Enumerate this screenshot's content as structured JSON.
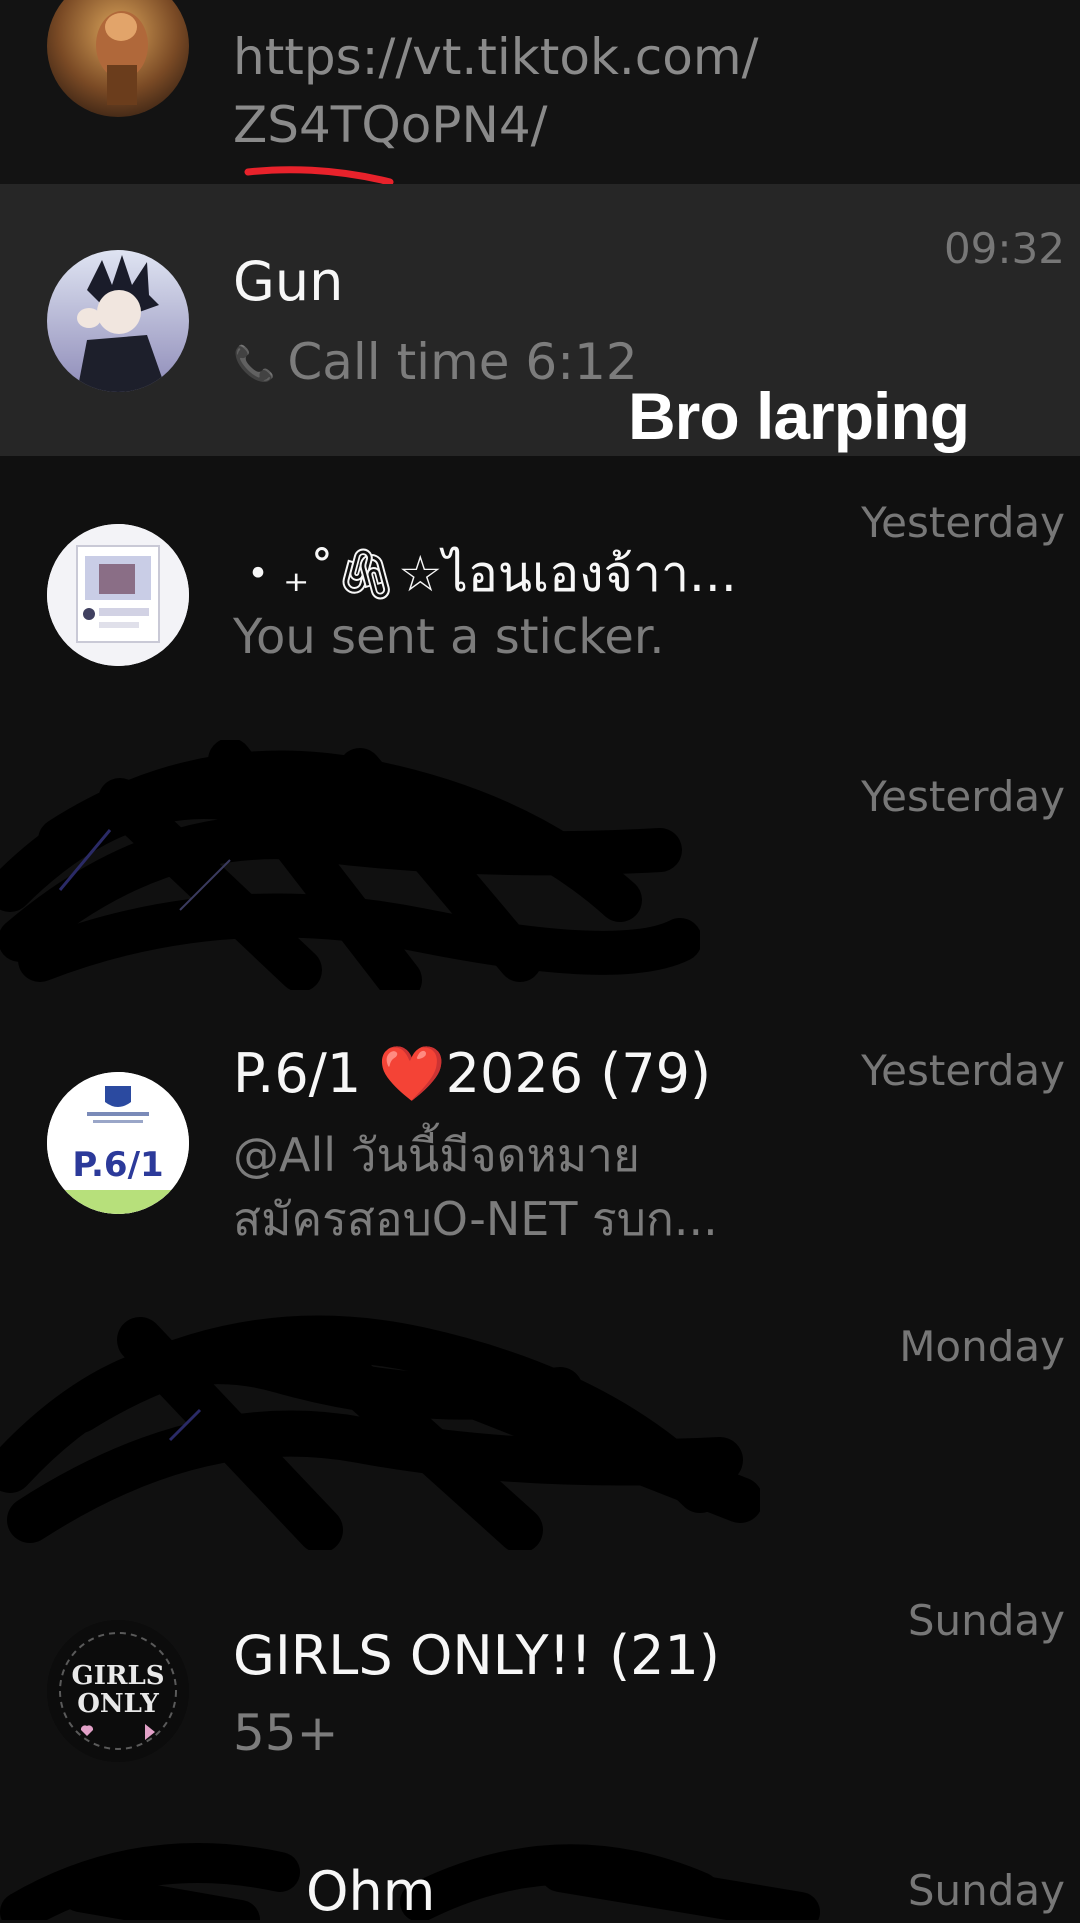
{
  "colors": {
    "background": "#101010",
    "highlight_row": "#262626",
    "underline": "#e8222b",
    "muted_text": "#7c7c7c",
    "time_text": "#777777"
  },
  "rows": [
    {
      "preview_line1": "https://vt.tiktok.com/",
      "preview_line2": "ZS4TQoPN4/"
    },
    {
      "name": "Gun",
      "preview": "Call time 6:12",
      "time": "09:32",
      "preview_icon": "phone-icon"
    },
    {
      "name": "・₊˚🖇☆ไอนเองจ้าา...",
      "preview": "You sent a sticker.",
      "time": "Yesterday"
    },
    {
      "time": "Yesterday"
    },
    {
      "name": "P.6/1 ❤️2026 (79)",
      "preview_line1": "@All วันนี้มีจดหมาย",
      "preview_line2": "สมัครสอบO-NET รบก...",
      "time": "Yesterday",
      "avatar_text": "P.6/1"
    },
    {
      "time": "Monday"
    },
    {
      "name": "GIRLS ONLY!! (21)",
      "preview": "55+",
      "time": "Sunday",
      "avatar_text_1": "GIRLS",
      "avatar_text_2": "ONLY"
    },
    {
      "name": "Ohm",
      "time": "Sunday"
    }
  ],
  "overlay": {
    "caption": "Bro larping"
  }
}
